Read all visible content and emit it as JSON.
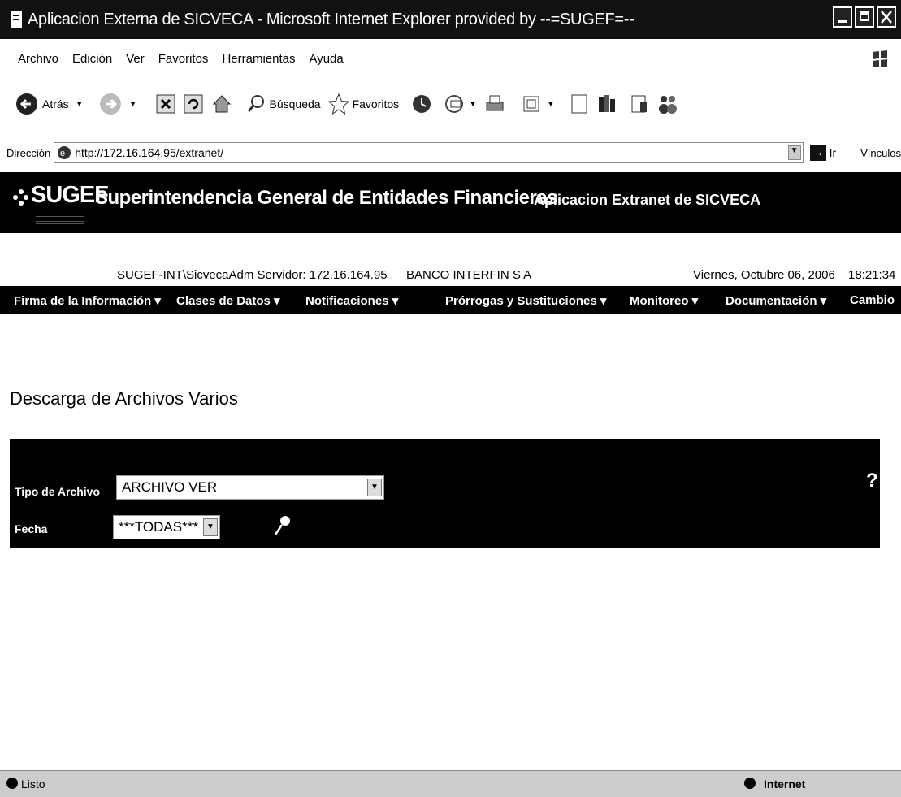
{
  "window": {
    "title": "Aplicacion Externa de SICVECA - Microsoft Internet Explorer provided by --=SUGEF=--"
  },
  "menu": [
    "Archivo",
    "Edición",
    "Ver",
    "Favoritos",
    "Herramientas",
    "Ayuda"
  ],
  "toolbar": {
    "back_label": "Atrás",
    "search_label": "Búsqueda",
    "favorites_label": "Favoritos"
  },
  "address": {
    "label": "Dirección",
    "url": "http://172.16.164.95/extranet/",
    "go_label": "Ir",
    "links_label": "Vínculos"
  },
  "site": {
    "logo": "SUGEF",
    "org_title": "Superintendencia General de Entidades Financieras",
    "app_title": "Aplicacion Extranet de SICVECA",
    "user_server": "SUGEF-INT\\SicvecaAdm Servidor: 172.16.164.95",
    "entity": "BANCO INTERFIN S A",
    "date": "Viernes, Octubre 06, 2006",
    "time": "18:21:34"
  },
  "nav": [
    "Firma de la Información ▾",
    "Clases de Datos ▾",
    "Notificaciones ▾",
    "Prórrogas y Sustituciones ▾",
    "Monitoreo ▾",
    "Documentación ▾",
    "Cambio"
  ],
  "page": {
    "title": "Descarga de Archivos Varios"
  },
  "form": {
    "tipo_label": "Tipo de Archivo",
    "tipo_value": "ARCHIVO VER",
    "fecha_label": "Fecha",
    "fecha_value": "***TODAS***",
    "help": "?"
  },
  "status": {
    "text": "Listo",
    "zone": "Internet"
  }
}
